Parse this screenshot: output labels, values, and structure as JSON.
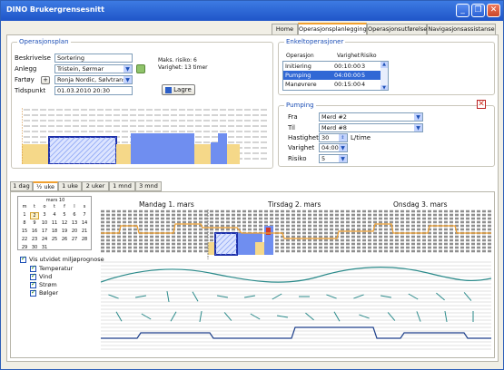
{
  "window": {
    "title": "DINO Brukergrensesnitt"
  },
  "tabs": [
    "Home",
    "Operasjonsplanlegging",
    "Operasjonsutførelse",
    "Navigasjonsassistanse"
  ],
  "active_tab": "Operasjonsplanlegging",
  "operasjonsplan": {
    "legend": "Operasjonsplan",
    "beskrivelse_label": "Beskrivelse",
    "beskrivelse_value": "Sortering",
    "anlegg_label": "Anlegg",
    "anlegg_value": "Tristein, Sørmar",
    "fartoy_label": "Fartøy",
    "fartoy_value": "Ronja Nordic, Sølvtrans",
    "tidspunkt_label": "Tidspunkt",
    "tidspunkt_value": "01.03.2010  20:30",
    "maks_risiko": "Maks. risiko: 6",
    "varighet": "Varighet: 13 timer",
    "lagre_label": "Lagre",
    "plus": "+"
  },
  "enkeltoperasjoner": {
    "legend": "Enkeltoperasjoner",
    "headers": [
      "Operasjon",
      "Varighet",
      "Risiko"
    ],
    "rows": [
      {
        "op": "Initiering",
        "dur": "00:10:00",
        "risk": "3"
      },
      {
        "op": "Pumping",
        "dur": "04:00:00",
        "risk": "5"
      },
      {
        "op": "Manøvrere",
        "dur": "00:15:00",
        "risk": "4"
      }
    ],
    "selected": 1
  },
  "pumping": {
    "legend": "Pumping",
    "fra_label": "Fra",
    "fra_value": "Merd #2",
    "til_label": "Til",
    "til_value": "Merd #8",
    "hastighet_label": "Hastighet",
    "hastighet_value": "30",
    "hastighet_unit": "L/time",
    "varighet_label": "Varighet",
    "varighet_value": "04:00",
    "risiko_label": "Risiko",
    "risiko_value": "5"
  },
  "time_tabs": [
    "1 dag",
    "½ uke",
    "1 uke",
    "2 uker",
    "1 mnd",
    "3 mnd"
  ],
  "active_time_tab": "½ uke",
  "calendar": {
    "month": "mars 10",
    "weekdays": [
      "m",
      "t",
      "o",
      "t",
      "f",
      "l",
      "s"
    ],
    "rows": [
      [
        "1",
        "2",
        "3",
        "4",
        "5",
        "6",
        "7"
      ],
      [
        "8",
        "9",
        "10",
        "11",
        "12",
        "13",
        "14"
      ],
      [
        "15",
        "16",
        "17",
        "18",
        "19",
        "20",
        "21"
      ],
      [
        "22",
        "23",
        "24",
        "25",
        "26",
        "27",
        "28"
      ],
      [
        "29",
        "30",
        "31",
        "",
        "",
        "",
        ""
      ]
    ]
  },
  "prognose": {
    "main": "Vis utvidet miljøprognose",
    "items": [
      "Temperatur",
      "Vind",
      "Strøm",
      "Bølger"
    ]
  },
  "days": [
    "Mandag 1. mars",
    "Tirsdag 2. mars",
    "Onsdag 3. mars"
  ],
  "colors": {
    "accent": "#1d4fb6",
    "orange": "#f0a030",
    "teal": "#2a8a8a",
    "blue_bar": "#6f8ef0",
    "yellow": "#f5d889",
    "red": "#d23a2a"
  }
}
